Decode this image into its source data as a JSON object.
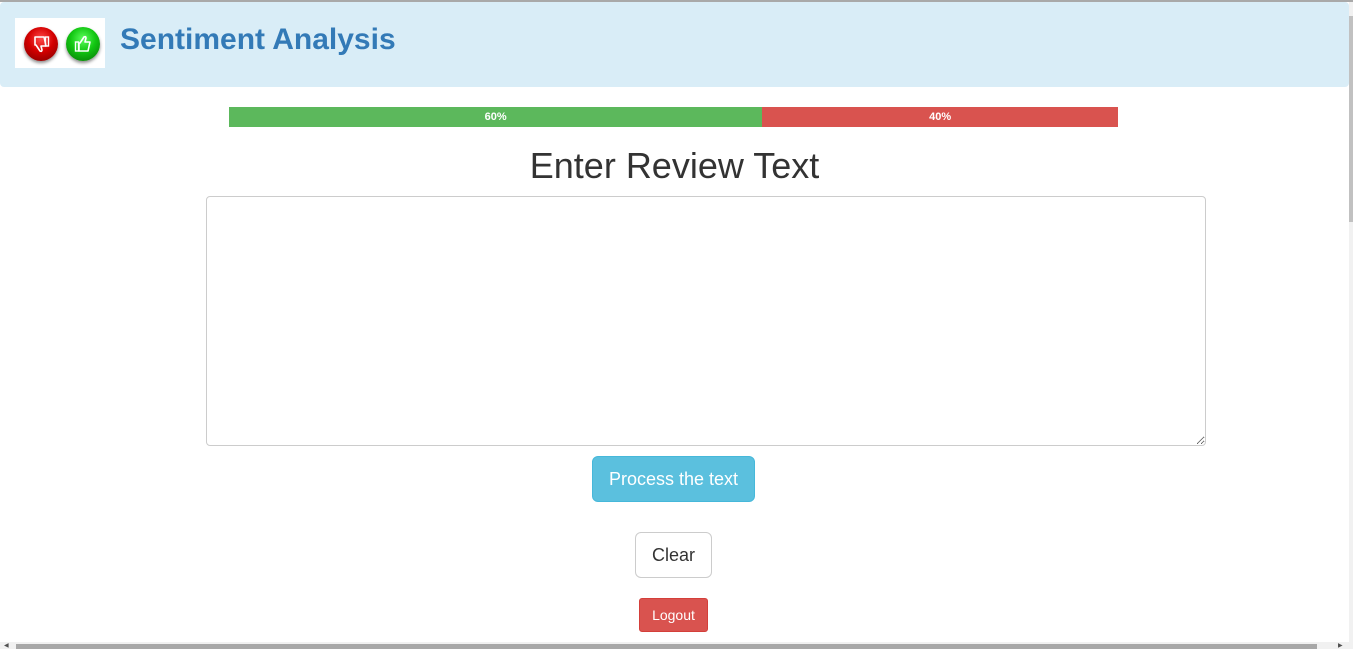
{
  "header": {
    "brand": "Sentiment Analysis",
    "logo_icons": [
      "thumbs-down-icon",
      "thumbs-up-icon"
    ]
  },
  "sentiment_bar": {
    "positive": {
      "label": "60%",
      "value": 0.6,
      "color": "#5cb85c"
    },
    "negative": {
      "label": "40%",
      "value": 0.4,
      "color": "#d9534f"
    }
  },
  "main": {
    "heading": "Enter Review Text",
    "review_text": "",
    "process_label": "Process the text",
    "clear_label": "Clear",
    "logout_label": "Logout"
  },
  "colors": {
    "navbar_bg": "#d9edf7",
    "brand": "#337ab7",
    "info_button": "#5bc0de",
    "danger_button": "#d9534f"
  }
}
